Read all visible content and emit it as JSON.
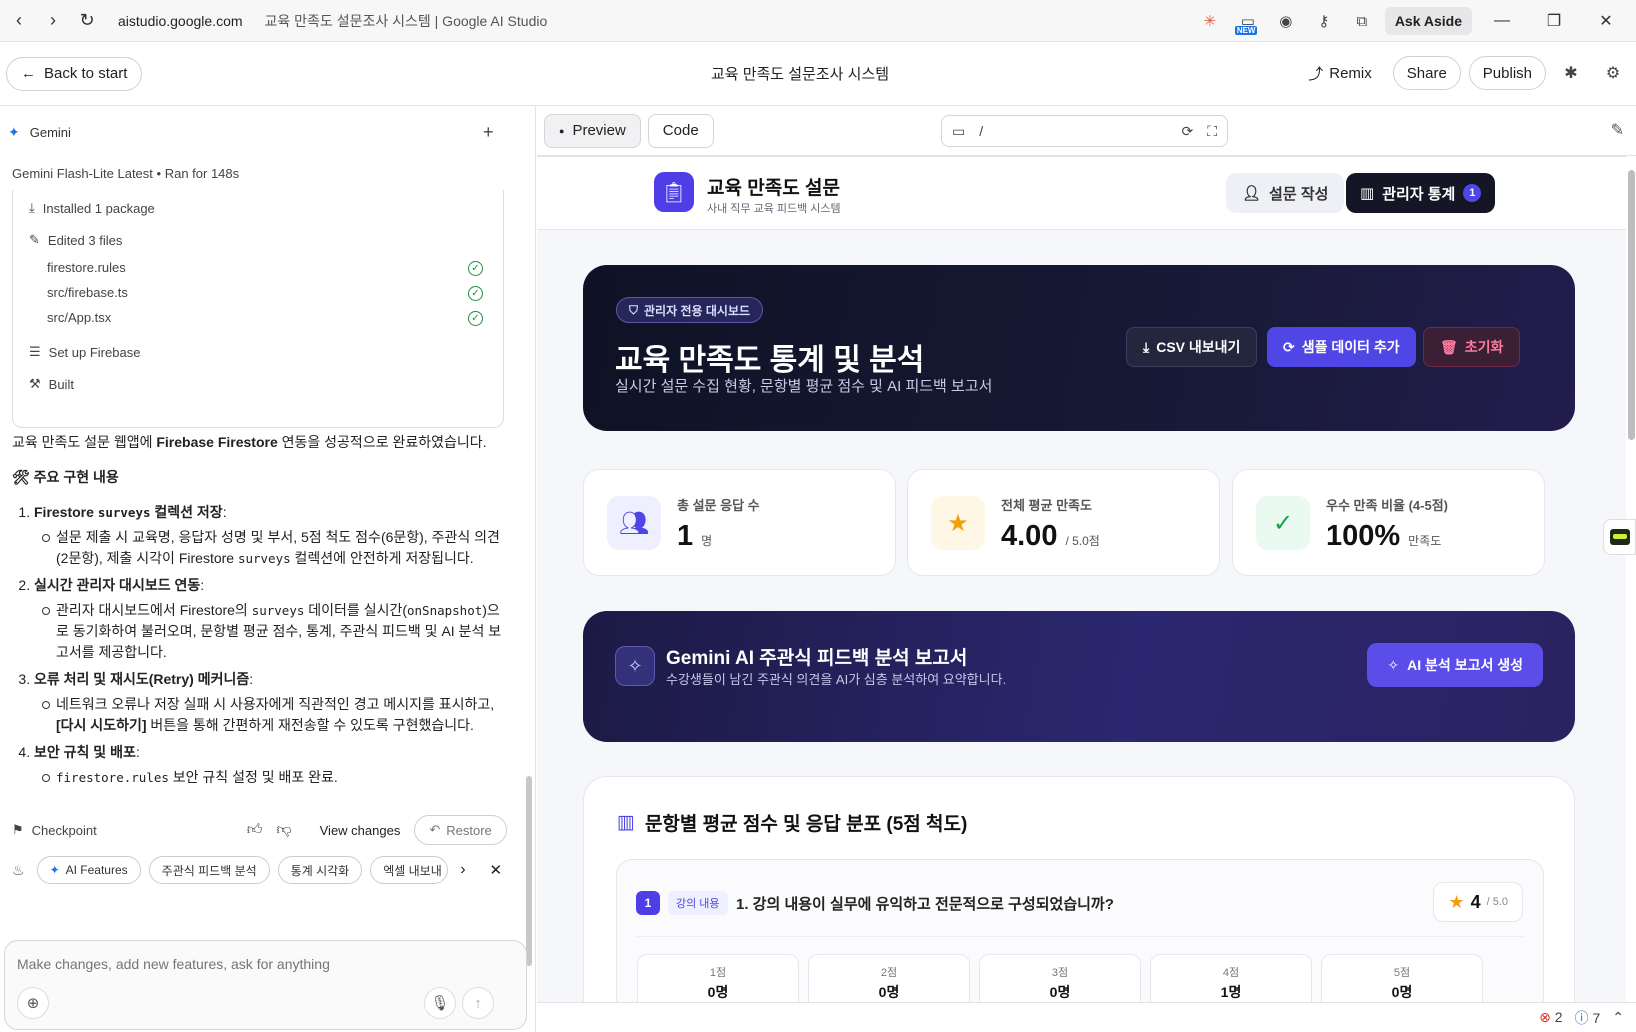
{
  "browser": {
    "url": "aistudio.google.com",
    "tab_title": "교육 만족도 설문조사 시스템 | Google AI Studio",
    "ask_aside": "Ask Aside",
    "new_badge": "NEW"
  },
  "header": {
    "back_label": "Back to start",
    "title": "교육 만족도 설문조사 시스템",
    "remix": "Remix",
    "share": "Share",
    "publish": "Publish"
  },
  "chat": {
    "gemini_label": "Gemini",
    "model": "Gemini Flash-Lite Latest",
    "ran_for": "Ran for 148s",
    "steps": {
      "installed": "Installed 1 package",
      "edited": "Edited 3 files",
      "files": [
        "firestore.rules",
        "src/firebase.ts",
        "src/App.tsx"
      ],
      "setup": "Set up Firebase",
      "built": "Built"
    },
    "intro_pre": "교육 만족도 설문 웹앱에 ",
    "intro_bold": "Firebase Firestore",
    "intro_post": " 연동을 성공적으로 완료하였습니다.",
    "section_title": "🛠 주요 구현 내용",
    "items": [
      {
        "head_a": "Firestore ",
        "head_code": "surveys",
        "head_b": " 컬렉션 저장",
        "body_a": "설문 제출 시 교육명, 응답자 성명 및 부서, 5점 척도 점수(6문항), 주관식 의견(2문항), 제출 시각이 Firestore ",
        "body_code": "surveys",
        "body_b": " 컬렉션에 안전하게 저장됩니다."
      },
      {
        "head": "실시간 관리자 대시보드 연동",
        "body_a": "관리자 대시보드에서 Firestore의 ",
        "body_code": "surveys",
        "body_b": " 데이터를 실시간(",
        "body_code2": "onSnapshot",
        "body_c": ")으로 동기화하여 불러오며, 문항별 평균 점수, 통계, 주관식 피드백 및 AI 분석 보고서를 제공합니다."
      },
      {
        "head": "오류 처리 및 재시도(Retry) 메커니즘",
        "body_a": "네트워크 오류나 저장 실패 시 사용자에게 직관적인 경고 메시지를 표시하고, ",
        "body_bold": "[다시 시도하기]",
        "body_b": " 버튼을 통해 간편하게 재전송할 수 있도록 구현했습니다."
      },
      {
        "head": "보안 규칙 및 배포",
        "body_code": "firestore.rules",
        "body_b": " 보안 규칙 설정 및 배포 완료."
      }
    ],
    "checkpoint": "Checkpoint",
    "view_changes": "View changes",
    "restore": "Restore",
    "chips": [
      "AI Features",
      "주관식 피드백 분석",
      "통계 시각화",
      "엑셀 내보내"
    ],
    "input_placeholder": "Make changes, add new features, ask for anything"
  },
  "preview": {
    "tab_preview": "Preview",
    "tab_code": "Code",
    "address": "/",
    "app": {
      "title": "교육 만족도 설문",
      "subtitle": "사내 직무 교육 피드백 시스템",
      "nav_survey": "설문 작성",
      "nav_admin": "관리자 통계",
      "nav_admin_count": "1"
    },
    "hero": {
      "badge": "관리자 전용 대시보드",
      "title": "교육 만족도 통계 및 분석",
      "subtitle": "실시간 설문 수집 현황, 문항별 평균 점수 및 AI 피드백 보고서",
      "csv": "CSV 내보내기",
      "sample": "샘플 데이터 추가",
      "reset": "초기화"
    },
    "stats": [
      {
        "label": "총 설문 응답 수",
        "value": "1",
        "unit": "명",
        "icon": "users-icon",
        "color": "#4f46e5"
      },
      {
        "label": "전체 평균 만족도",
        "value": "4.00",
        "unit": "/ 5.0점",
        "icon": "star-icon",
        "color": "#f59e0b"
      },
      {
        "label": "우수 만족 비율 (4-5점)",
        "value": "100%",
        "unit": "만족도",
        "icon": "check-circle-icon",
        "color": "#16a34a"
      }
    ],
    "ai": {
      "title": "Gemini AI 주관식 피드백 분석 보고서",
      "subtitle": "수강생들이 남긴 주관식 의견을 AI가 심층 분석하여 요약합니다.",
      "button": "AI 분석 보고서 생성"
    },
    "questions": {
      "title": "문항별 평균 점수 및 응답 분포 (5점 척도)",
      "item": {
        "number": "1",
        "category": "강의 내용",
        "text": "1. 강의 내용이 실무에 유익하고 전문적으로 구성되었습니까?",
        "score": "4",
        "score_max": "/ 5.0",
        "dist": [
          {
            "label": "1점",
            "count": "0명"
          },
          {
            "label": "2점",
            "count": "0명"
          },
          {
            "label": "3점",
            "count": "0명"
          },
          {
            "label": "4점",
            "count": "1명"
          },
          {
            "label": "5점",
            "count": "0명"
          }
        ]
      }
    },
    "status": {
      "errors": "2",
      "infos": "7"
    }
  }
}
